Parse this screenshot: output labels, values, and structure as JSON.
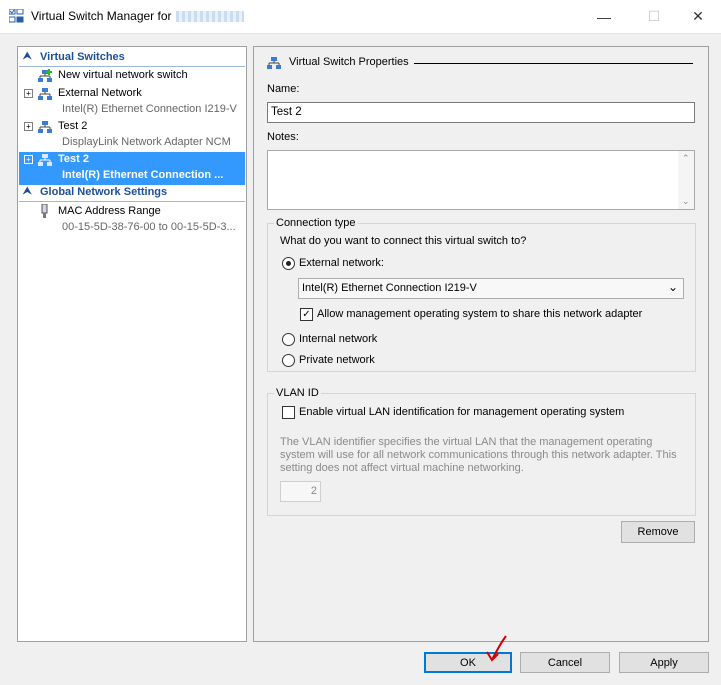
{
  "window": {
    "title": "Virtual Switch Manager for",
    "minimize_glyph": "—",
    "maximize_glyph": "☐",
    "close_glyph": "✕"
  },
  "tree": {
    "virtual_switches_header": "Virtual Switches",
    "items": [
      {
        "label": "New virtual network switch",
        "sublabel": "",
        "icon": "new-switch-icon"
      },
      {
        "label": "External Network",
        "sublabel": "Intel(R) Ethernet Connection I219-V",
        "icon": "network-switch-icon"
      },
      {
        "label": "Test 2",
        "sublabel": "DisplayLink Network Adapter NCM",
        "icon": "network-switch-icon"
      },
      {
        "label": "Test 2",
        "sublabel": "Intel(R) Ethernet Connection ...",
        "icon": "network-switch-icon",
        "selected": true
      }
    ],
    "global_header": "Global Network Settings",
    "global_items": [
      {
        "label": "MAC Address Range",
        "sublabel": "00-15-5D-38-76-00 to 00-15-5D-3...",
        "icon": "mac-address-icon"
      }
    ],
    "expand_glyph": "+",
    "collapse_glyph": "⌃"
  },
  "properties": {
    "title": "Virtual Switch Properties",
    "name_label": "Name:",
    "name_value": "Test 2",
    "notes_label": "Notes:",
    "notes_value": "",
    "connection_type": {
      "legend": "Connection type",
      "question": "What do you want to connect this virtual switch to?",
      "external_label": "External network:",
      "external_selected": true,
      "adapter_value": "Intel(R) Ethernet Connection I219-V",
      "allow_mgmt_label": "Allow management operating system to share this network adapter",
      "allow_mgmt_checked": true,
      "internal_label": "Internal network",
      "private_label": "Private network"
    },
    "vlan": {
      "legend": "VLAN ID",
      "enable_label": "Enable virtual LAN identification for management operating system",
      "enable_checked": false,
      "description": "The VLAN identifier specifies the virtual LAN that the management operating system will use for all network communications through this network adapter. This setting does not affect virtual machine networking.",
      "vlan_value": "2"
    },
    "remove_label": "Remove"
  },
  "footer": {
    "ok_label": "OK",
    "cancel_label": "Cancel",
    "apply_label": "Apply"
  },
  "colors": {
    "accent": "#0078d7",
    "selection": "#3399ff",
    "section_header": "#1e4e9a",
    "annotation_arrow": "#d40000"
  }
}
